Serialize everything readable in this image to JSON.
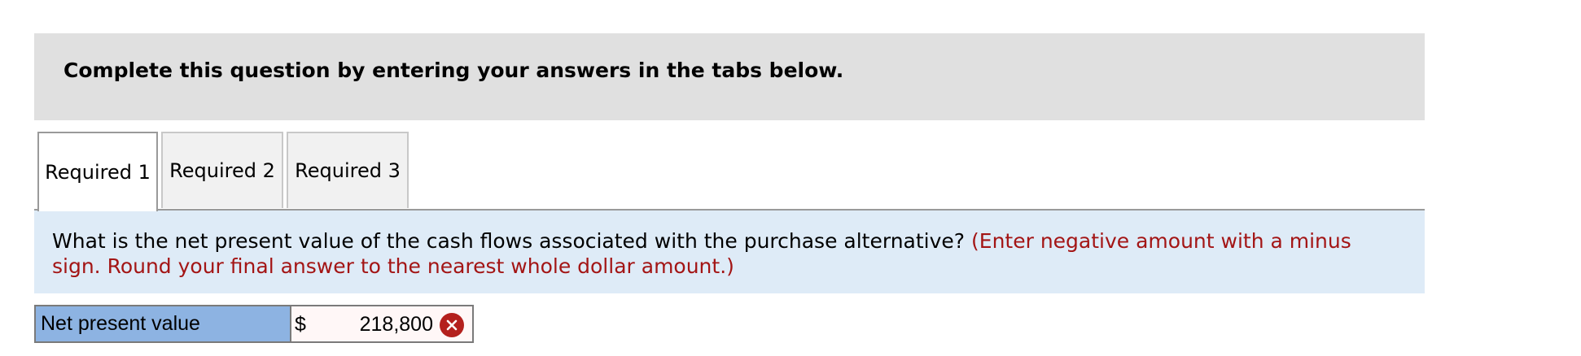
{
  "banner": {
    "instruction": "Complete this question by entering your answers in the tabs below."
  },
  "tabs": [
    {
      "label": "Required 1",
      "active": true
    },
    {
      "label": "Required 2",
      "active": false
    },
    {
      "label": "Required 3",
      "active": false
    }
  ],
  "question": {
    "text": "What is the net present value of the cash flows associated with the purchase alternative? ",
    "note": "(Enter negative amount with a minus sign. Round your final answer to the nearest whole dollar amount.)"
  },
  "answer": {
    "label": "Net present value",
    "currency": "$",
    "value": "218,800",
    "status": "incorrect",
    "status_icon": "incorrect-x-icon"
  },
  "colors": {
    "banner_bg": "#e0e0e0",
    "question_bg": "#deebf7",
    "note_text": "#a31515",
    "label_bg": "#8db3e2",
    "incorrect_icon": "#b4201d"
  }
}
